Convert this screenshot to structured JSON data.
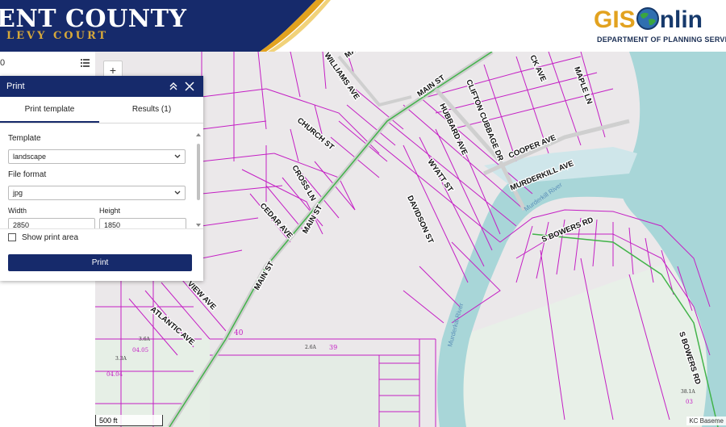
{
  "header": {
    "county_title": "ENT COUNTY",
    "levy_court": "LEVY COURT",
    "gis_text": "GIS",
    "online_text": "nlin",
    "department": "DEPARTMENT OF PLANNING SERVICES G"
  },
  "sidebar": {
    "value": "0"
  },
  "print_panel": {
    "title": "Print",
    "tabs": [
      "Print template",
      "Results (1)"
    ],
    "template_label": "Template",
    "template_value": "landscape",
    "file_format_label": "File format",
    "file_format_value": "jpg",
    "width_label": "Width",
    "width_value": "2850",
    "height_label": "Height",
    "height_value": "1850",
    "show_print_area_label": "Show print area",
    "print_button": "Print"
  },
  "map": {
    "zoom_in": "+",
    "scale": "500 ft",
    "attribution": "KC Baseme",
    "streets": {
      "main_st_north": "MAIN ST",
      "main_st_top": "MAIN ST",
      "main_st_mid": "MAIN ST",
      "main_st_south": "MAIN ST",
      "williams_ave": "WILLIAMS AVE",
      "clifton_cubbage_dr": "CLIFTON CUBBAGE DR",
      "hubbard_ave": "HUBBARD AVE",
      "church_st": "CHURCH ST",
      "cross_ln": "CROSS LN",
      "cedar_ave": "CEDAR AVE",
      "wyatt_st": "WYATT ST",
      "davidson_st": "DAVIDSON ST",
      "cooper_ave": "COOPER AVE",
      "murderkill_ave": "MURDERKILL AVE",
      "maple_ln": "MAPLE LN",
      "ck_ave": "CK AVE",
      "s_bowers_rd_top": "S BOWERS RD",
      "s_bowers_rd_right": "S BOWERS RD",
      "view_ave": "VIEW AVE",
      "atlantic_ave": "ATLANTIC AVE"
    },
    "river_label_1": "Murderkill River",
    "river_label_2": "Murderkill River",
    "parcels": [
      "40",
      "39",
      "2.6A",
      "04.05",
      "3.6A",
      "3.3A",
      "04.04",
      "38.1A",
      "03"
    ]
  },
  "colors": {
    "navy": "#162a6b",
    "gold": "#d6a83a",
    "parcel": "#c41fc4",
    "water": "#a8d6d8",
    "road": "#42b34a"
  }
}
